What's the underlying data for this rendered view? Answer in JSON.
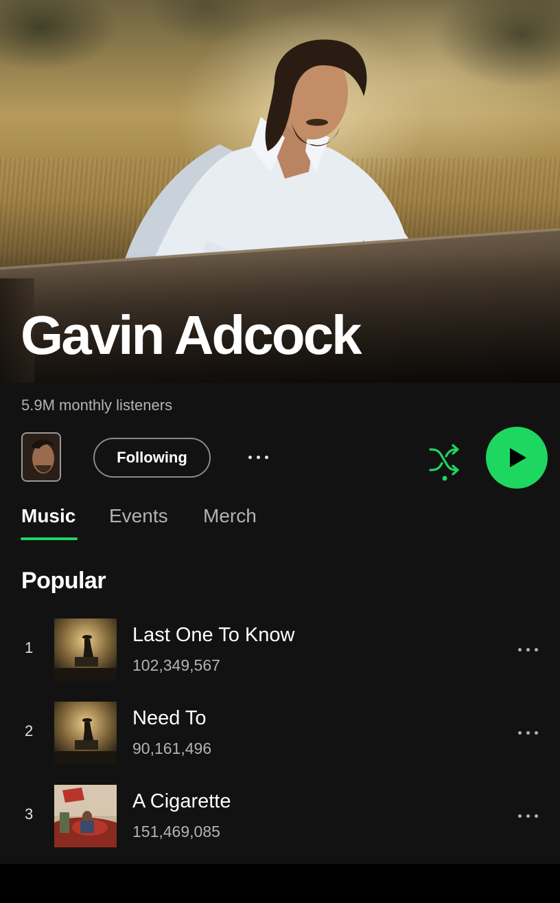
{
  "artist": {
    "name": "Gavin Adcock",
    "monthly_listeners": "5.9M monthly listeners"
  },
  "actions": {
    "following_label": "Following",
    "more_icon": "more-horizontal-icon",
    "shuffle_icon": "shuffle-icon",
    "play_icon": "play-icon",
    "accent_color": "#1ed760"
  },
  "tabs": [
    {
      "label": "Music",
      "active": true
    },
    {
      "label": "Events",
      "active": false
    },
    {
      "label": "Merch",
      "active": false
    }
  ],
  "popular": {
    "title": "Popular",
    "tracks": [
      {
        "rank": "1",
        "title": "Last One To Know",
        "plays": "102,349,567"
      },
      {
        "rank": "2",
        "title": "Need To",
        "plays": "90,161,496"
      },
      {
        "rank": "3",
        "title": "A Cigarette",
        "plays": "151,469,085"
      }
    ]
  }
}
